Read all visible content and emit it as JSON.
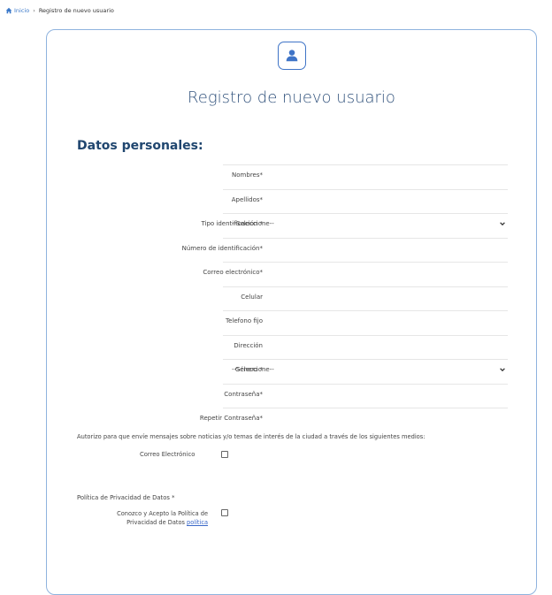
{
  "breadcrumb": {
    "home": "Inicio",
    "current": "Registro de nuevo usuario"
  },
  "title": "Registro de nuevo usuario",
  "section_title": "Datos personales:",
  "fields": [
    {
      "label": "Nombres*",
      "type": "text",
      "value": ""
    },
    {
      "label": "Apellidos*",
      "type": "text",
      "value": ""
    },
    {
      "label": "Tipo identificación *",
      "type": "select",
      "value": "--Seleccione--"
    },
    {
      "label": "Número de identificación*",
      "type": "text",
      "value": ""
    },
    {
      "label": "Correo electrónico*",
      "type": "text",
      "value": ""
    },
    {
      "label": "Celular",
      "type": "text",
      "value": ""
    },
    {
      "label": "Telefono fijo",
      "type": "text",
      "value": ""
    },
    {
      "label": "Dirección",
      "type": "text",
      "value": ""
    },
    {
      "label": "Género *",
      "type": "select",
      "value": "--Seleccione--"
    },
    {
      "label": "Contraseña*",
      "type": "password",
      "value": ""
    },
    {
      "label": "Repetir Contraseña*",
      "type": "password",
      "value": ""
    }
  ],
  "consent": {
    "text": "Autorizo para que envíe mensajes sobre noticias y/o temas de interés de la ciudad a través de los siguientes medios:",
    "email_option": "Correo Electrónico",
    "email_checked": false
  },
  "privacy": {
    "title": "Política de Privacidad de Datos  *",
    "text": "Conozco y Acepto la Política de Privacidad de Datos",
    "link": "política",
    "checked": false
  },
  "colors": {
    "accent": "#3f74c7",
    "title": "#31527c",
    "section": "#20466f",
    "link": "#3a68c8"
  },
  "icons": {
    "home": "home-icon",
    "avatar": "user-avatar-icon",
    "select": "chevron-down-icon"
  }
}
